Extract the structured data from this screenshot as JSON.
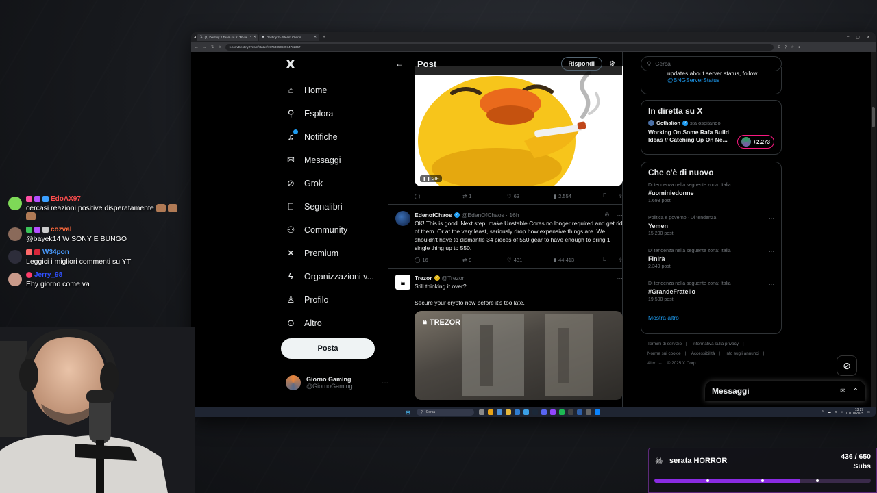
{
  "browser": {
    "tabs": [
      {
        "label": "(1) Destiny 2 Team su X: \"Ri-ve...\""
      },
      {
        "label": "Destiny 2 - Steam Charts"
      }
    ],
    "new_tab": "+",
    "url": "x.com/Destiny2Team/status/1975385060574732357",
    "window_controls": [
      "–",
      "▢",
      "✕"
    ]
  },
  "nav": {
    "logo": "X",
    "items": [
      {
        "label": "Home",
        "icon": "home-icon"
      },
      {
        "label": "Esplora",
        "icon": "search-icon"
      },
      {
        "label": "Notifiche",
        "icon": "bell-icon"
      },
      {
        "label": "Messaggi",
        "icon": "mail-icon"
      },
      {
        "label": "Grok",
        "icon": "grok-icon"
      },
      {
        "label": "Segnalibri",
        "icon": "bookmark-icon"
      },
      {
        "label": "Community",
        "icon": "people-icon"
      },
      {
        "label": "Premium",
        "icon": "x-icon"
      },
      {
        "label": "Organizzazioni v...",
        "icon": "lightning-icon"
      },
      {
        "label": "Profilo",
        "icon": "person-icon"
      },
      {
        "label": "Altro",
        "icon": "more-circle-icon"
      }
    ],
    "post_button": "Posta",
    "profile": {
      "name": "Giorno Gaming",
      "handle": "@GiornoGaming",
      "more": "···"
    }
  },
  "center": {
    "header": {
      "title": "Post",
      "reply_button": "Rispondi"
    },
    "gif_badge": "GIF",
    "first_actions": {
      "replies": "",
      "reposts": "1",
      "likes": "63",
      "views": "2.554"
    },
    "tweets": [
      {
        "name": "EdenofChaos",
        "handle": "@EdenOfChaos · 16h",
        "text": "OK! This is good. Next step, make Unstable Cores no longer required and get rid of them. Or at the very least, seriously drop how expensive things are. We shouldn't have to dismantle 34 pieces of 550 gear to have enough to bring 1 single thing up to 550.",
        "replies": "16",
        "reposts": "9",
        "likes": "431",
        "views": "44.413"
      },
      {
        "name": "Trezor",
        "handle": "@Trezor",
        "text1": "Still thinking it over?",
        "text2": "Secure your crypto now before it's too late.",
        "card_logo": "TREZOR"
      }
    ]
  },
  "right": {
    "search_placeholder": "Cerca",
    "top_card": {
      "text": "updates about server status, follow",
      "link": "@BNGServerStatus"
    },
    "live": {
      "title": "In diretta su X",
      "host": "Gothalion",
      "host_suffix": "sta ospitando",
      "stream_title": "Working On Some Rafa Build Ideas // Catching Up On Ne...",
      "viewers": "+2.273"
    },
    "trends": {
      "title": "Che c'è di nuovo",
      "items": [
        {
          "context": "Di tendenza nella seguente zona: Italia",
          "name": "#uominiedonne",
          "count": "1.693 post"
        },
        {
          "context": "Politica e governo · Di tendenza",
          "name": "Yemen",
          "count": "15.200 post"
        },
        {
          "context": "Di tendenza nella seguente zona: Italia",
          "name": "Finirà",
          "count": "2.349 post"
        },
        {
          "context": "Di tendenza nella seguente zona: Italia",
          "name": "#GrandeFratello",
          "count": "19.500 post"
        }
      ],
      "show_more": "Mostra altro"
    },
    "footer": [
      "Termini di servizio",
      "|",
      "Informativa sulla privacy",
      "|",
      "Norme sui cookie",
      "|",
      "Accessibilità",
      "|",
      "Info sugli annunci",
      "|",
      "Altro ···",
      "© 2025 X Corp."
    ]
  },
  "messages_drawer": {
    "title": "Messaggi"
  },
  "taskbar": {
    "search": "Cerca",
    "time": "13:27",
    "date": "07/10/2025"
  },
  "chat": [
    {
      "user": "EdoAX97",
      "color": "#ff4d4d",
      "text": "cercasi reazioni positive disperatamente"
    },
    {
      "user": "cozval",
      "color": "#ff6a3d",
      "text": "@bayek14 W SONY E BUNGO"
    },
    {
      "user": "W34pon",
      "color": "#4a9cff",
      "text": "Leggici i migliori commenti su YT"
    },
    {
      "user": "Jerry_98",
      "color": "#3050ff",
      "text": "Ehy giorno come va"
    }
  ],
  "subgoal": {
    "name": "serata HORROR",
    "current": 436,
    "target": 650,
    "count_text": "436 / 650",
    "unit": "Subs",
    "progress": 0.67
  }
}
